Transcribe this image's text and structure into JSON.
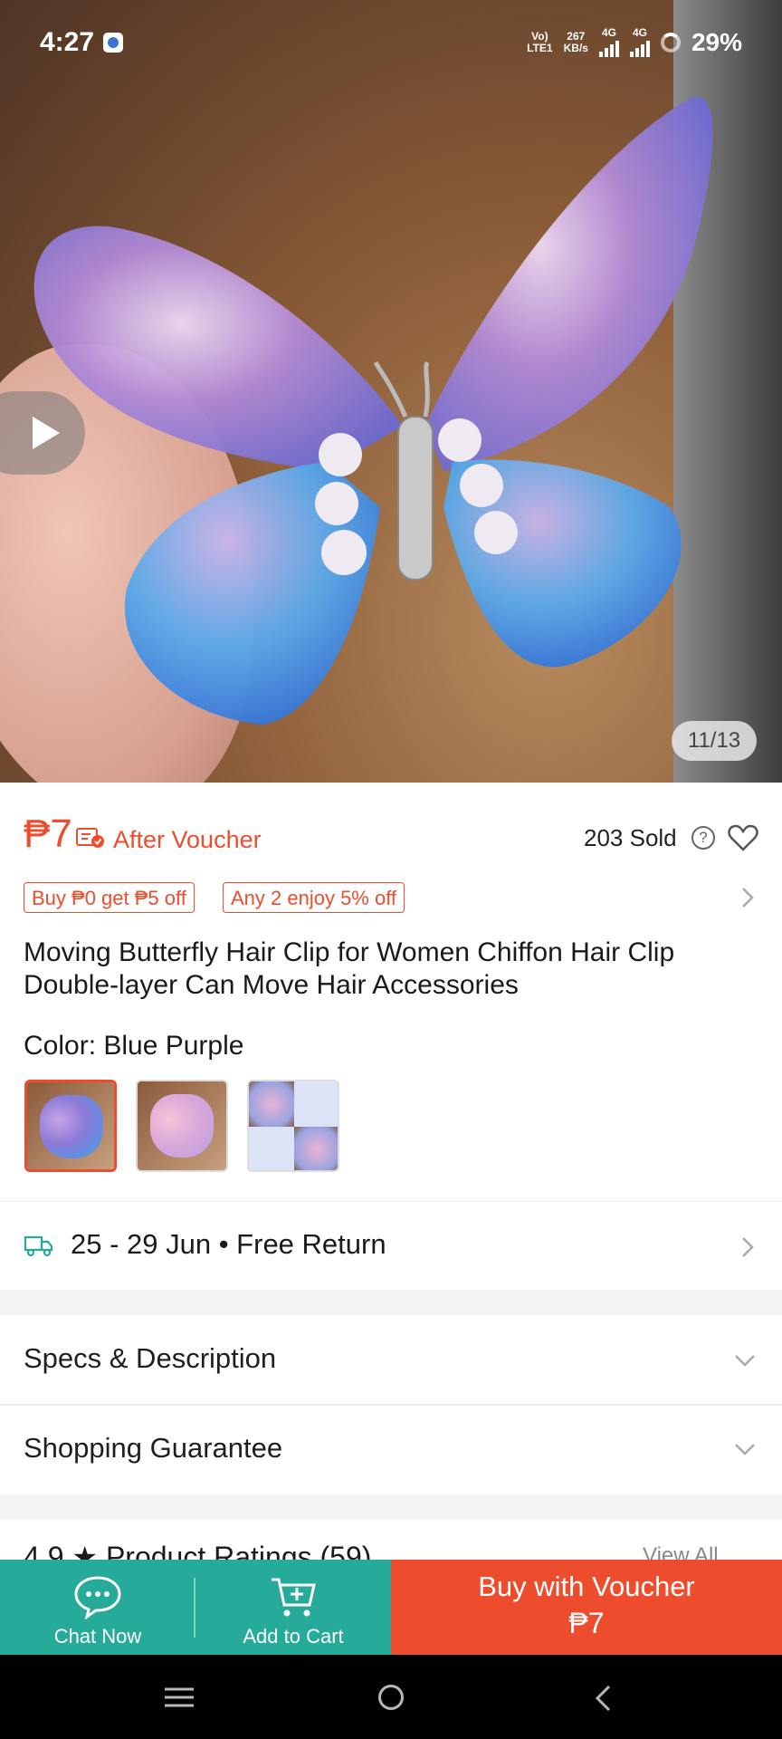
{
  "status_bar": {
    "time": "4:27",
    "volte_top": "Vo)",
    "volte_bottom": "LTE1",
    "speed_value": "267",
    "speed_unit": "KB/s",
    "net1": "4G",
    "net2": "4G",
    "battery": "29%"
  },
  "gallery": {
    "counter": "11/13"
  },
  "product": {
    "price": "₱7",
    "after_voucher": "After Voucher",
    "sold": "203 Sold",
    "promos": [
      "Buy ₱0 get ₱5 off",
      "Any 2 enjoy 5% off"
    ],
    "title": "Moving Butterfly Hair Clip for Women Chiffon Hair Clip Double-layer Can Move Hair Accessories",
    "color_label": "Color: Blue Purple"
  },
  "delivery": {
    "text": "25 - 29 Jun • Free Return"
  },
  "sections": {
    "specs": "Specs & Description",
    "guarantee": "Shopping Guarantee",
    "ratings_peek": "4.9 ★ Product Ratings (59)",
    "view_all_peek": "View All"
  },
  "bottom_bar": {
    "chat": "Chat Now",
    "cart": "Add to Cart",
    "buy": "Buy with Voucher",
    "buy_price": "₱7"
  },
  "colors": {
    "accent": "#ee4d2d",
    "teal": "#26aa99"
  }
}
